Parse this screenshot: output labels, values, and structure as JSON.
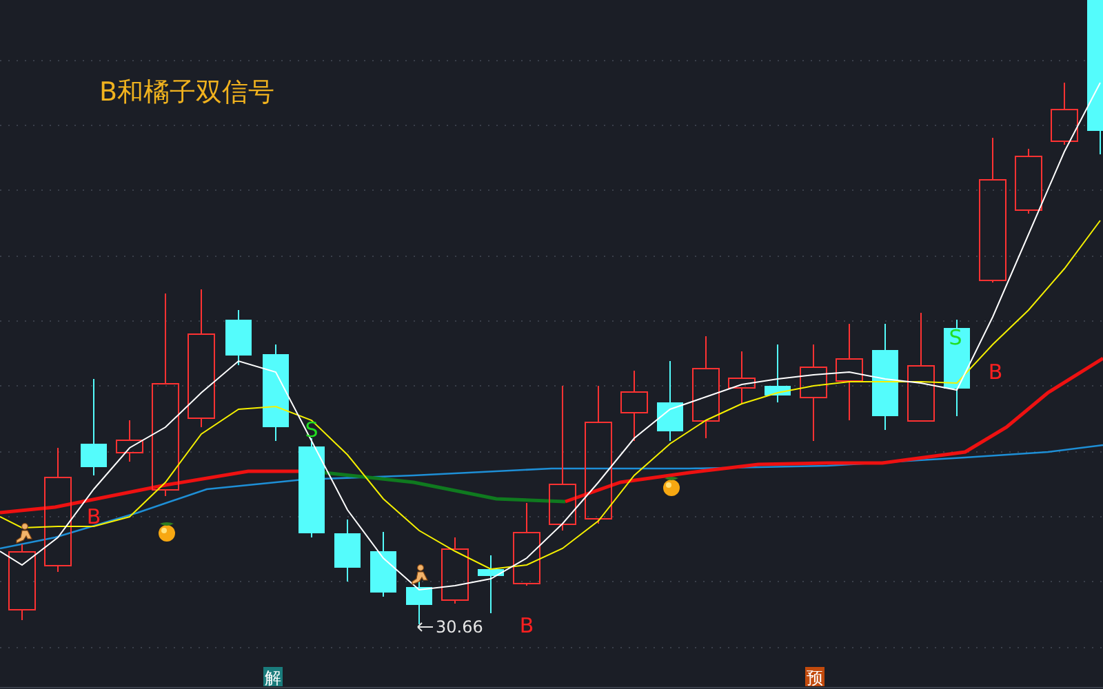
{
  "title": "B和橘子双信号",
  "signals": [
    {
      "text": "B",
      "kind": "buy"
    },
    {
      "text": "S",
      "kind": "sell"
    },
    {
      "text": "B",
      "kind": "buy"
    },
    {
      "text": "S",
      "kind": "sell"
    },
    {
      "text": "B",
      "kind": "buy"
    }
  ],
  "low_label": "30.66",
  "badges": [
    {
      "text": "解",
      "kind": "solve"
    },
    {
      "text": "预",
      "kind": "warn"
    }
  ]
}
